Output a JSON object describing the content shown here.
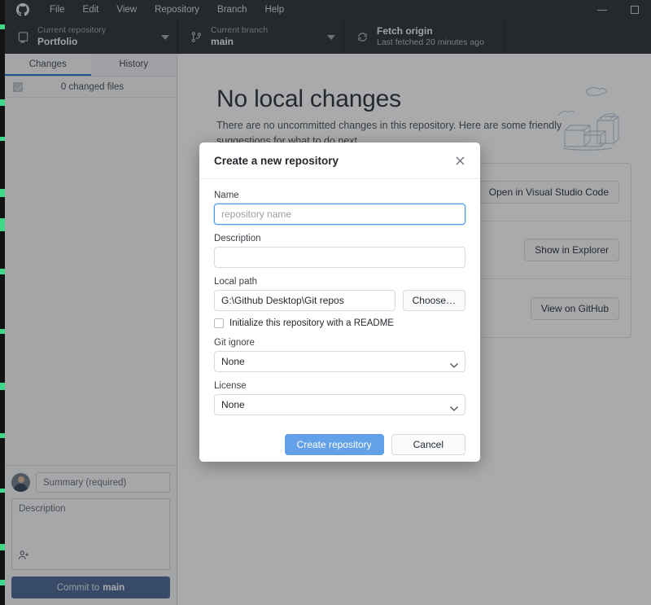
{
  "titlebar": {
    "logo_icon": "github-mark-icon",
    "menus": [
      "File",
      "Edit",
      "View",
      "Repository",
      "Branch",
      "Help"
    ],
    "window_controls": [
      {
        "name": "minimize",
        "icon": "minimize-icon"
      },
      {
        "name": "maximize",
        "icon": "maximize-icon"
      }
    ]
  },
  "toolbar": {
    "repository": {
      "icon": "repo-icon",
      "label": "Current repository",
      "value": "Portfolio",
      "chevron": "chevron-down-icon"
    },
    "branch": {
      "icon": "git-branch-icon",
      "label": "Current branch",
      "value": "main",
      "chevron": "chevron-down-icon"
    },
    "fetch": {
      "icon": "sync-icon",
      "label": "Fetch origin",
      "value": "Last fetched 20 minutes ago"
    }
  },
  "sidebar": {
    "tabs": [
      {
        "label": "Changes",
        "active": true
      },
      {
        "label": "History",
        "active": false
      }
    ],
    "changed_files_label": "0 changed files",
    "commit": {
      "avatar": "user-avatar",
      "summary_placeholder": "Summary (required)",
      "description_placeholder": "Description",
      "coauthor_icon": "add-coauthor-icon",
      "button_prefix": "Commit to",
      "button_branch": "main"
    }
  },
  "main": {
    "title": "No local changes",
    "subtitle": "There are no uncommitted changes in this repository. Here are some friendly suggestions for what to do next.",
    "illustration": "empty-boxes-illustration",
    "suggestions": [
      {
        "text": "",
        "button": "Open in Visual Studio Code"
      },
      {
        "text": "",
        "button": "Show in Explorer"
      },
      {
        "text": "",
        "button": "View on GitHub"
      }
    ]
  },
  "dialog": {
    "title": "Create a new repository",
    "close_icon": "close-icon",
    "fields": {
      "name_label": "Name",
      "name_value": "",
      "name_placeholder": "repository name",
      "description_label": "Description",
      "description_value": "",
      "local_path_label": "Local path",
      "local_path_value": "G:\\Github Desktop\\Git repos",
      "choose_button": "Choose…",
      "readme_checkbox_label": "Initialize this repository with a README",
      "readme_checked": false,
      "gitignore_label": "Git ignore",
      "gitignore_value": "None",
      "license_label": "License",
      "license_value": "None"
    },
    "buttons": {
      "primary": "Create repository",
      "secondary": "Cancel"
    }
  },
  "colors": {
    "titlebar_bg": "#24292e",
    "accent_blue": "#1a6fd4",
    "primary_button": "#62a0e8",
    "commit_button": "#41628f"
  }
}
